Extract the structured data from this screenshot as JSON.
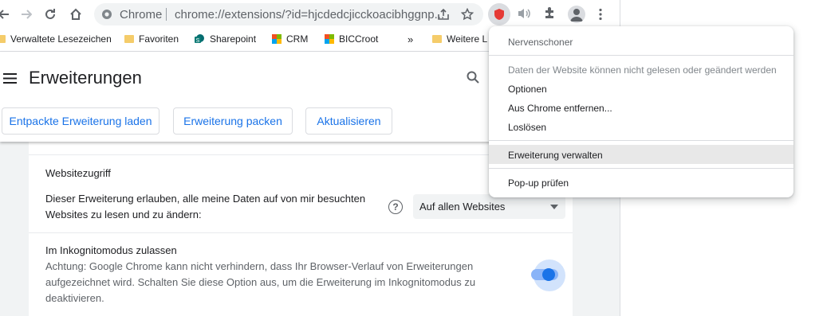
{
  "toolbar": {
    "site_label": "Chrome",
    "url": "chrome://extensions/?id=hjcdedcjicckoacibhggnp..."
  },
  "bookmarks": [
    {
      "label": "Verwaltete Lesezeichen"
    },
    {
      "label": "Favoriten"
    },
    {
      "label": "Sharepoint"
    },
    {
      "label": "CRM"
    },
    {
      "label": "BICCroot"
    },
    {
      "label": "Weitere L"
    }
  ],
  "bookmarks_overflow": "»",
  "header": {
    "title": "Erweiterungen",
    "buttons": [
      "Entpackte Erweiterung laden",
      "Erweiterung packen",
      "Aktualisieren"
    ]
  },
  "site_access": {
    "title": "Websitezugriff",
    "description_line1": "Dieser Erweiterung erlauben, alle meine Daten auf von mir besuchten",
    "description_line2": "Websites zu lesen und zu ändern:",
    "help_glyph": "?",
    "selected_option": "Auf allen Websites"
  },
  "incognito": {
    "title": "Im Inkognitomodus zulassen",
    "line1": "Achtung: Google Chrome kann nicht verhindern, dass Ihr Browser-Verlauf von Erweiterungen",
    "line2": "aufgezeichnet wird. Schalten Sie diese Option aus, um die Erweiterung im Inkognitomodus zu",
    "line3": "deaktivieren.",
    "enabled": true
  },
  "menu": {
    "extension_name": "Nervenschoner",
    "info": "Daten der Website können nicht gelesen oder geändert werden",
    "options": "Optionen",
    "remove": "Aus Chrome entfernen...",
    "unpin": "Loslösen",
    "manage": "Erweiterung verwalten",
    "inspect": "Pop-up prüfen"
  },
  "colors": {
    "accent": "#1a73e8",
    "extension_icon": "#e53935",
    "menu_highlight": "#e8e8e8"
  }
}
